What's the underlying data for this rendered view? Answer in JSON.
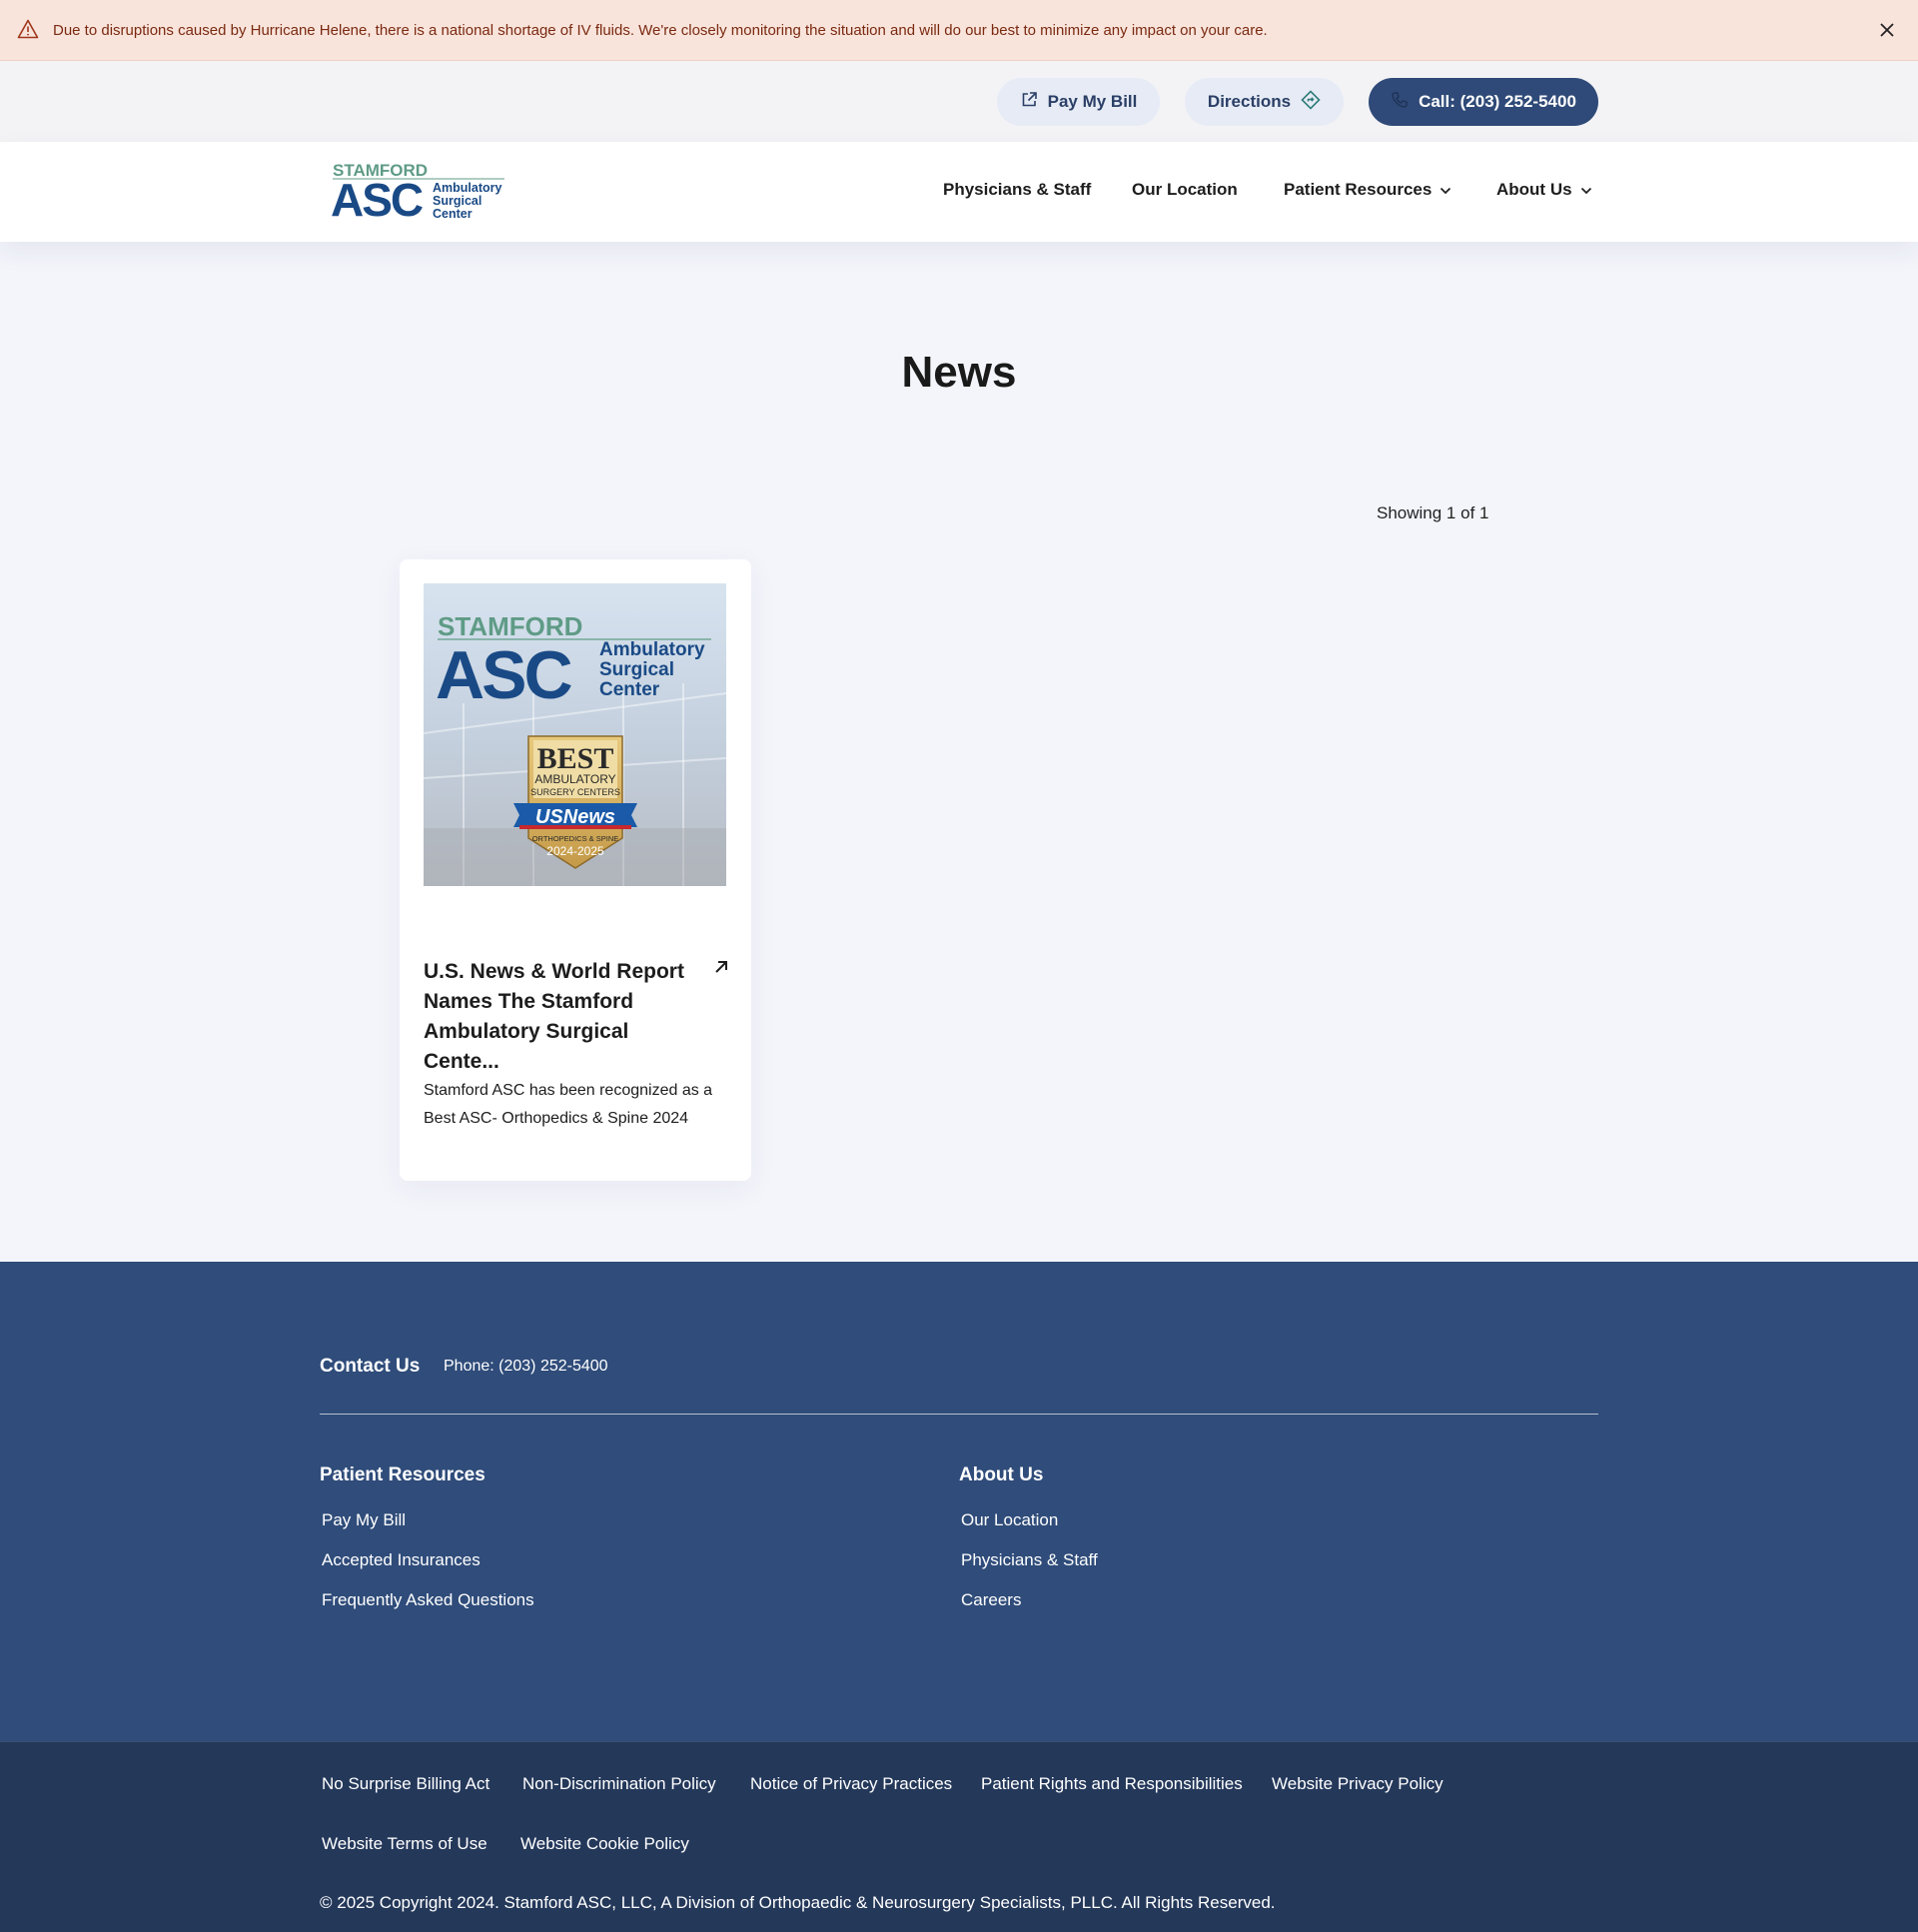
{
  "alert": {
    "text": "Due to disruptions caused by Hurricane Helene, there is a national shortage of IV fluids. We're closely monitoring the situation and will do our best to minimize any impact on your care."
  },
  "utility": {
    "pay_bill": "Pay My Bill",
    "directions": "Directions",
    "call": "Call: (203) 252-5400"
  },
  "logo": {
    "line1": "STAMFORD",
    "big": "ASC",
    "line2": "Ambulatory",
    "line3": "Surgical",
    "line4": "Center"
  },
  "nav": {
    "physicians": "Physicians & Staff",
    "location": "Our Location",
    "resources": "Patient Resources",
    "about": "About Us"
  },
  "main": {
    "title": "News",
    "showing": "Showing 1 of 1",
    "card": {
      "title": "U.S. News & World Report Names The Stamford Ambulatory Surgical Cente...",
      "description": "Stamford ASC has been recognized as a Best ASC- Orthopedics & Spine 2024",
      "badge": {
        "best": "BEST",
        "ambulatory": "AMBULATORY",
        "surgery_centers": "SURGERY CENTERS",
        "usnews": "USNews",
        "specialty": "ORTHOPEDICS & SPINE",
        "years": "2024-2025"
      }
    }
  },
  "footer": {
    "contact_label": "Contact Us",
    "phone": "Phone: (203) 252-5400",
    "col1": {
      "heading": "Patient Resources",
      "links": [
        "Pay My Bill",
        "Accepted Insurances",
        "Frequently Asked Questions"
      ]
    },
    "col2": {
      "heading": "About Us",
      "links": [
        "Our Location",
        "Physicians & Staff",
        "Careers"
      ]
    }
  },
  "legal": {
    "links": [
      "No Surprise Billing Act",
      "Non-Discrimination Policy",
      "Notice of Privacy Practices",
      "Patient Rights and Responsibilities",
      "Website Privacy Policy",
      "Website Terms of Use",
      "Website Cookie Policy"
    ],
    "copyright": "© 2025 Copyright 2024. Stamford ASC, LLC, A Division of Orthopaedic & Neurosurgery Specialists, PLLC. All Rights Reserved."
  },
  "colors": {
    "alert_bg": "#f9e4dc",
    "navy": "#2f4a78",
    "footer": "#2f4c7a",
    "legal": "#24385a",
    "logo_green": "#5f9b86",
    "logo_blue": "#1a4a86"
  }
}
